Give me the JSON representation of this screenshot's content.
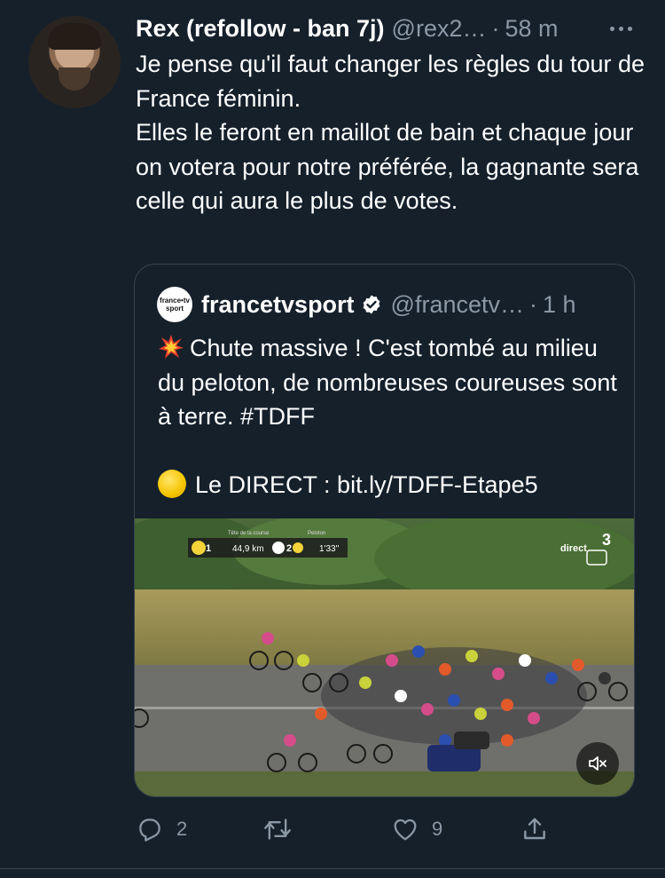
{
  "tweet": {
    "author_name": "Rex (refollow - ban 7j)",
    "handle": "@rex2…",
    "separator": "·",
    "time": "58 m",
    "more_icon": "more-horizontal-icon",
    "text_lines": [
      "Je pense qu'il faut changer les règles du tour de France féminin.",
      "Elles le feront en maillot de bain et chaque jour on votera pour notre préférée, la gagnante sera celle qui aura le plus de votes."
    ]
  },
  "quote": {
    "avatar_top": "france•tv",
    "avatar_bottom": "sport",
    "author_name": "francetvsport",
    "verified_icon": "verified-badge-icon",
    "handle": "@francetv…",
    "separator": "·",
    "time": "1 h",
    "text_line1": "Chute massive ! C'est tombé au milieu du peloton, de nombreuses coureuses sont à terre. #TDFF",
    "text_line2": "Le DIRECT : bit.ly/TDFF-Etape5",
    "emoji1_icon": "collision-emoji-icon",
    "emoji2_icon": "yellow-circle-emoji-icon",
    "media": {
      "overlay": {
        "rank1": "1",
        "head_label": "Tête de la course",
        "distance": "44,9 km",
        "rank2": "2",
        "peloton_label": "Peloton",
        "gap": "1'33''"
      },
      "channel_label": "direct",
      "channel_number": "3",
      "mute_icon": "speaker-muted-icon"
    }
  },
  "actions": {
    "reply_count": "2",
    "retweet_count": "",
    "like_count": "9",
    "reply_icon": "reply-icon",
    "retweet_icon": "retweet-icon",
    "like_icon": "heart-icon",
    "share_icon": "share-icon"
  },
  "colors": {
    "background": "#15202b",
    "secondary_text": "#8b98a5",
    "border": "#38444d",
    "verified": "#ffffff"
  }
}
